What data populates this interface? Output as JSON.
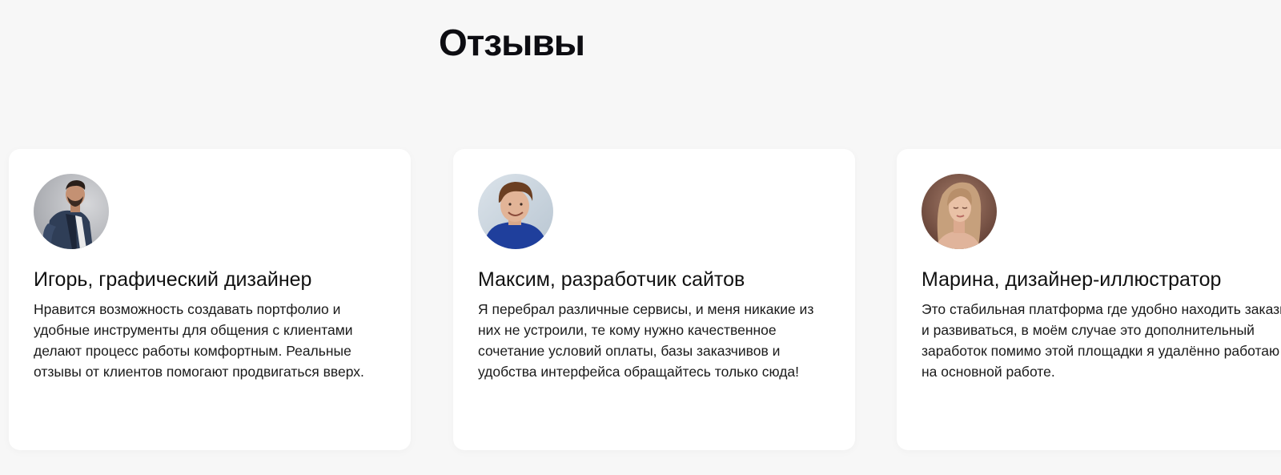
{
  "section": {
    "title": "Отзывы"
  },
  "reviews": [
    {
      "name": "Игорь, графический дизайнер",
      "text": "Нравится возможность создавать портфолио и удобные инструменты для общения с клиентами делают процесс работы комфортным. Реальные отзывы от клиентов помогают продвигаться вверх.",
      "avatar_icon": "man-in-denim-jacket-photo"
    },
    {
      "name": "Максим, разработчик сайтов",
      "text": "Я перебрал различные сервисы, и меня никакие из них не устроили, те кому нужно качественное сочетание условий оплаты, базы заказчивов и удобства интерфейса обращайтесь только сюда!",
      "avatar_icon": "smiling-man-photo"
    },
    {
      "name": "Марина, дизайнер-иллюстратор",
      "text": "Это стабильная платформа где удобно находить заказы и развиваться, в моём случае это дополнительный заработок помимо этой площадки я удалённо работаю на основной работе.",
      "avatar_icon": "woman-portrait-photo"
    }
  ],
  "colors": {
    "page_background": "#f7f7f7",
    "card_background": "#ffffff",
    "title_text": "#0d0d12",
    "body_text": "#1a1a1a"
  }
}
